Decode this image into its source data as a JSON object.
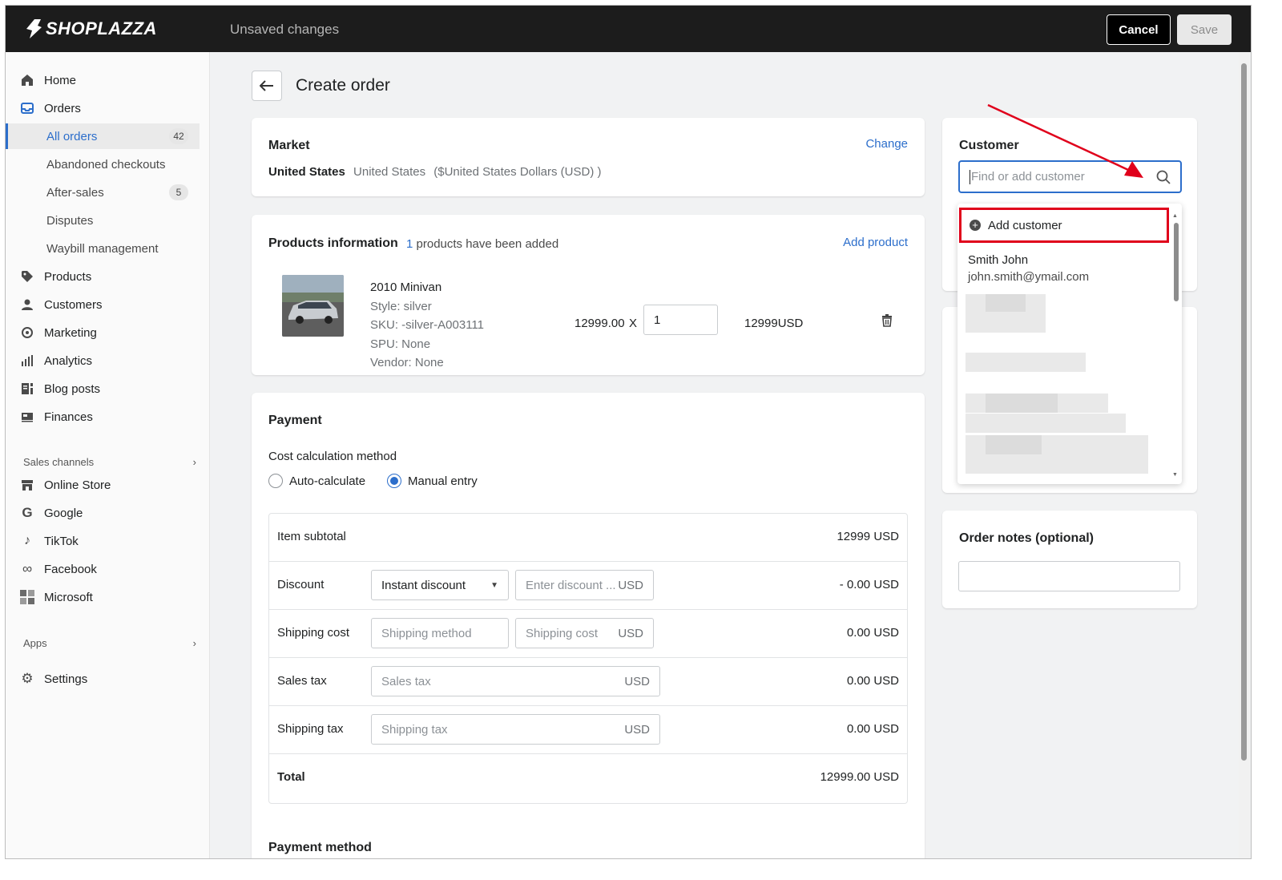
{
  "app": {
    "brand": "SHOPLAZZA",
    "unsaved": "Unsaved changes",
    "cancel": "Cancel",
    "save": "Save"
  },
  "sidebar": {
    "home": "Home",
    "orders": "Orders",
    "all_orders": "All orders",
    "all_orders_count": "42",
    "abandoned": "Abandoned checkouts",
    "after_sales": "After-sales",
    "after_sales_count": "5",
    "disputes": "Disputes",
    "waybill": "Waybill management",
    "products": "Products",
    "customers": "Customers",
    "marketing": "Marketing",
    "analytics": "Analytics",
    "blog": "Blog posts",
    "finances": "Finances",
    "sales_channels": "Sales channels",
    "online_store": "Online Store",
    "google": "Google",
    "tiktok": "TikTok",
    "facebook": "Facebook",
    "microsoft": "Microsoft",
    "apps": "Apps",
    "settings": "Settings"
  },
  "page": {
    "title": "Create order"
  },
  "market": {
    "title": "Market",
    "change": "Change",
    "country": "United States",
    "region": "United States",
    "currency": "($United States Dollars (USD) )"
  },
  "products": {
    "title": "Products information",
    "count": "1",
    "count_suffix": "products have been added",
    "add": "Add product",
    "item": {
      "name": "2010 Minivan",
      "style": "Style: silver",
      "sku": "SKU: -silver-A003111",
      "spu": "SPU: None",
      "vendor": "Vendor: None",
      "price": "12999.00",
      "times": "X",
      "qty": "1",
      "total": "12999USD"
    }
  },
  "payment": {
    "title": "Payment",
    "method_label": "Cost calculation method",
    "auto": "Auto-calculate",
    "manual": "Manual entry",
    "subtotal_label": "Item subtotal",
    "subtotal_value": "12999 USD",
    "discount_label": "Discount",
    "discount_type": "Instant discount",
    "discount_placeholder": "Enter discount ...",
    "usd": "USD",
    "discount_value": "- 0.00 USD",
    "shipping_label": "Shipping cost",
    "shipping_method_placeholder": "Shipping method",
    "shipping_cost_placeholder": "Shipping cost",
    "shipping_value": "0.00 USD",
    "sales_tax_label": "Sales tax",
    "sales_tax_placeholder": "Sales tax",
    "sales_tax_value": "0.00 USD",
    "shipping_tax_label": "Shipping tax",
    "shipping_tax_placeholder": "Shipping tax",
    "shipping_tax_value": "0.00 USD",
    "total_label": "Total",
    "total_value": "12999.00 USD",
    "payment_method": "Payment method"
  },
  "customer": {
    "title": "Customer",
    "placeholder": "Find or add customer",
    "add": "Add customer",
    "name": "Smith John",
    "email": "john.smith@ymail.com"
  },
  "notes": {
    "title": "Order notes (optional)"
  },
  "colors": {
    "accent": "#2c6ecb",
    "highlight": "#e0001b",
    "topbar": "#1c1c1c"
  }
}
